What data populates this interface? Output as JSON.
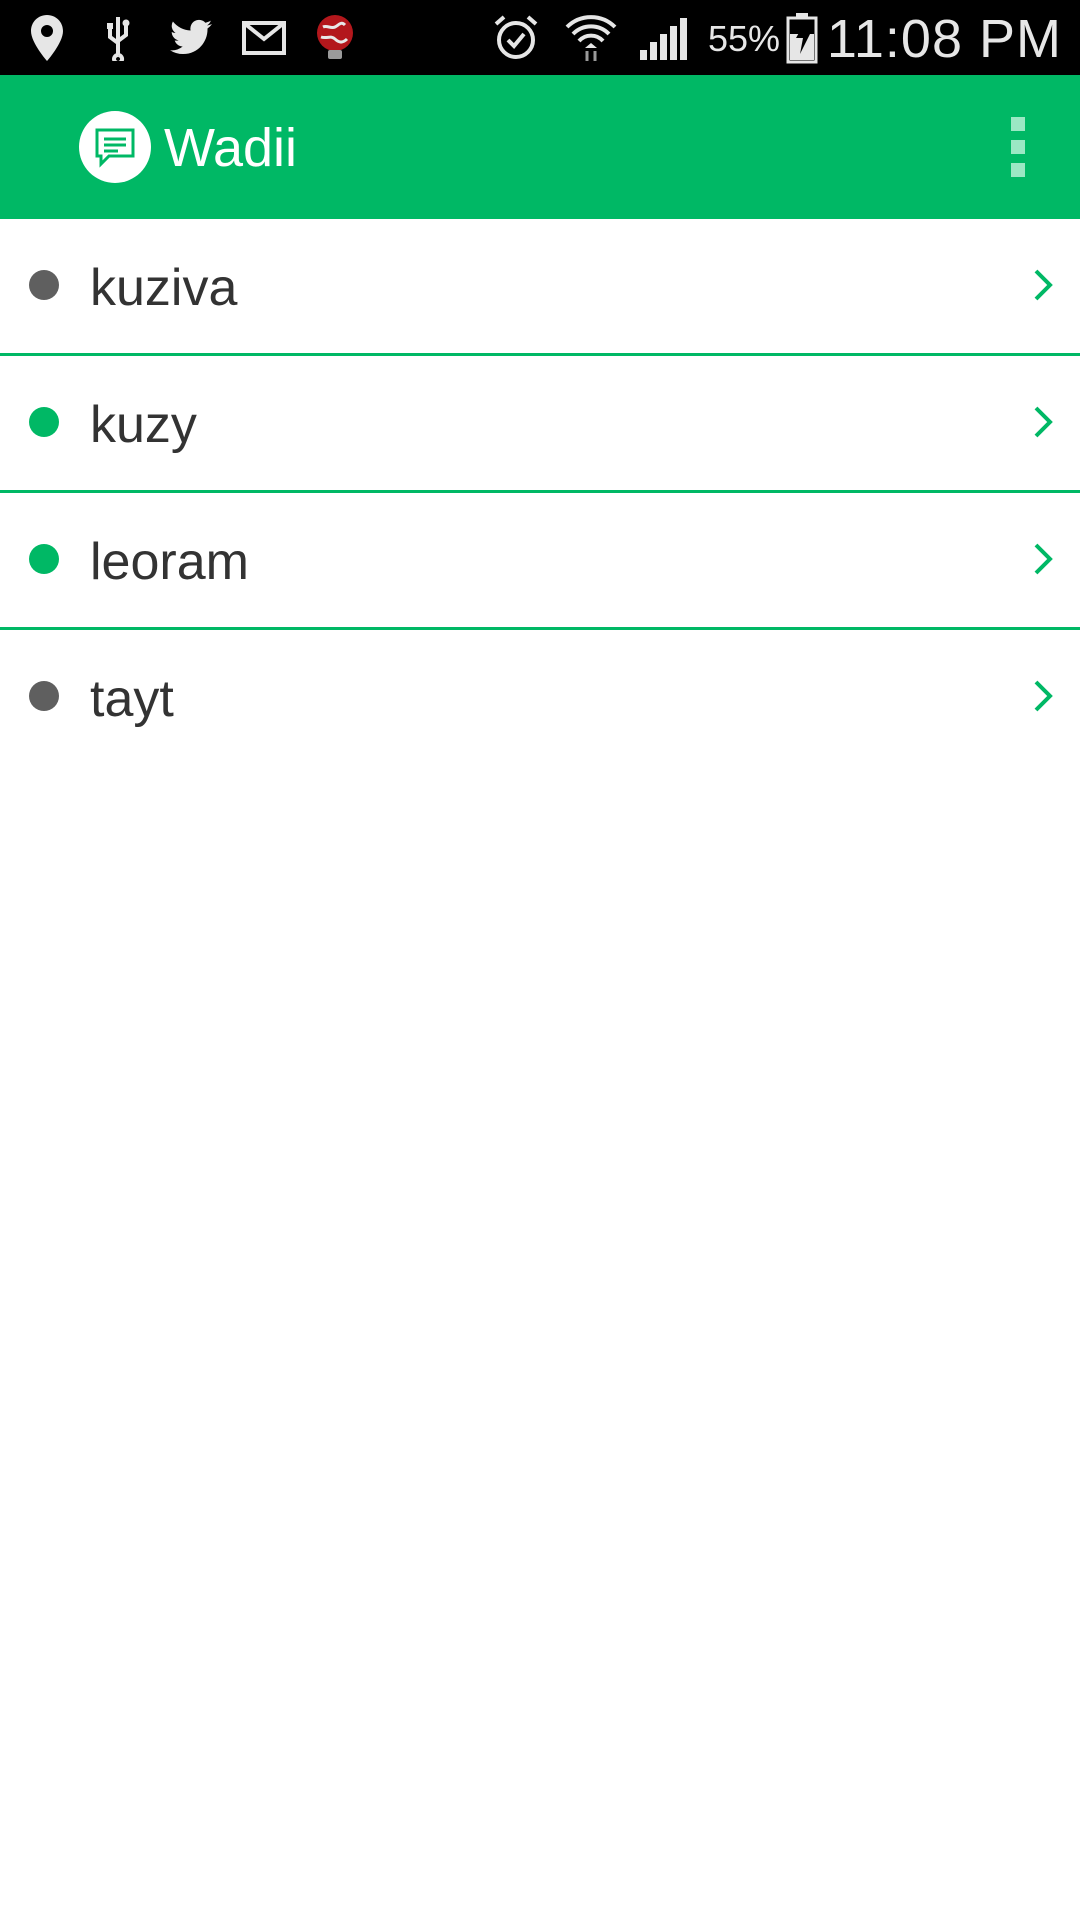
{
  "status_bar": {
    "left_icons": [
      "location-pin-icon",
      "usb-icon",
      "twitter-icon",
      "gmail-icon",
      "globe-bulb-icon"
    ],
    "right_icons": [
      "alarm-icon",
      "wifi-icon",
      "cell-signal-icon",
      "battery-charging-icon"
    ],
    "battery_percent": "55%",
    "time": "11:08 PM"
  },
  "app_bar": {
    "title": "Wadii",
    "logo_icon": "chat-bubble-icon",
    "menu_icon": "overflow-menu-icon",
    "color": "#00b865"
  },
  "contacts": [
    {
      "name": "kuziva",
      "status": "offline",
      "status_color": "#5f5f5f"
    },
    {
      "name": "kuzy",
      "status": "online",
      "status_color": "#00b865"
    },
    {
      "name": "leoram",
      "status": "online",
      "status_color": "#00b865"
    },
    {
      "name": "tayt",
      "status": "offline",
      "status_color": "#5f5f5f"
    }
  ],
  "colors": {
    "accent": "#00b865",
    "online": "#00b865",
    "offline": "#5f5f5f",
    "text": "#333333"
  }
}
